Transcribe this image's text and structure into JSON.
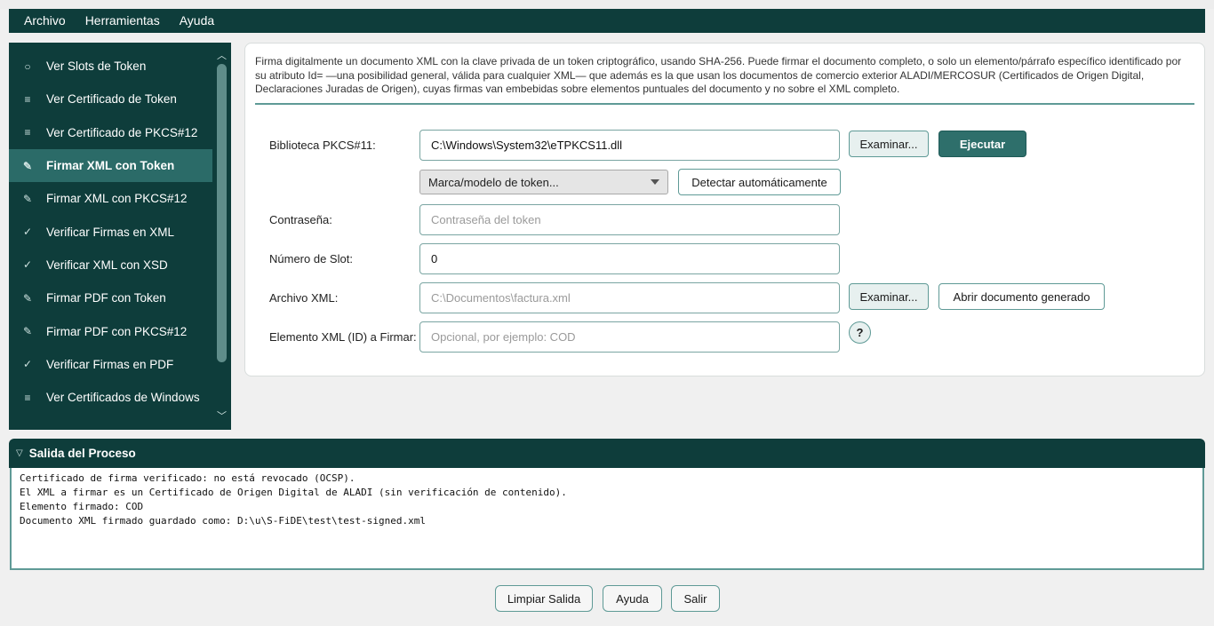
{
  "menubar": {
    "items": [
      "Archivo",
      "Herramientas",
      "Ayuda"
    ]
  },
  "sidebar": {
    "items": [
      {
        "icon": "○",
        "label": "Ver Slots de Token"
      },
      {
        "icon": "≡",
        "label": "Ver Certificado de Token"
      },
      {
        "icon": "≡",
        "label": "Ver Certificado de PKCS#12"
      },
      {
        "icon": "✎",
        "label": "Firmar XML con Token"
      },
      {
        "icon": "✎",
        "label": "Firmar XML con PKCS#12"
      },
      {
        "icon": "✓",
        "label": "Verificar Firmas en XML"
      },
      {
        "icon": "✓",
        "label": "Verificar XML con XSD"
      },
      {
        "icon": "✎",
        "label": "Firmar PDF con Token"
      },
      {
        "icon": "✎",
        "label": "Firmar PDF con PKCS#12"
      },
      {
        "icon": "✓",
        "label": "Verificar Firmas en PDF"
      },
      {
        "icon": "≡",
        "label": "Ver Certificados de Windows"
      }
    ],
    "active_label": "Firmar XML con Token"
  },
  "main": {
    "description": "Firma digitalmente un documento XML con la clave privada de un token criptográfico, usando SHA-256. Puede firmar el documento completo, o solo un elemento/párrafo específico identificado por su atributo Id= —una posibilidad general, válida para cualquier XML— que además es la que usan los documentos de comercio exterior ALADI/MERCOSUR (Certificados de Origen Digital, Declaraciones Juradas de Origen), cuyas firmas van embebidas sobre elementos puntuales del documento y no sobre el XML completo.",
    "library_label": "Biblioteca PKCS#11:",
    "library_value": "C:\\Windows\\System32\\eTPKCS11.dll",
    "browse_label": "Examinar...",
    "execute_label": "Ejecutar",
    "token_model_selected": "Marca/modelo de token...",
    "detect_label": "Detectar automáticamente",
    "password_label": "Contraseña:",
    "password_placeholder": "Contraseña del token",
    "slot_label": "Número de Slot:",
    "slot_value": "0",
    "xml_file_label": "Archivo XML:",
    "xml_file_placeholder": "C:\\Documentos\\factura.xml",
    "browse_xml_label": "Examinar...",
    "open_generated_label": "Abrir documento generado",
    "element_label": "Elemento XML (ID) a Firmar:",
    "element_placeholder": "Opcional, por ejemplo: COD",
    "help_label": "?"
  },
  "output": {
    "title": "Salida del Proceso",
    "lines": "Certificado de firma verificado: no está revocado (OCSP).\nEl XML a firmar es un Certificado de Origen Digital de ALADI (sin verificación de contenido).\nElemento firmado: COD\nDocumento XML firmado guardado como: D:\\u\\S-FiDE\\test\\test-signed.xml"
  },
  "footer": {
    "clear_label": "Limpiar Salida",
    "help_label": "Ayuda",
    "exit_label": "Salir"
  },
  "colors": {
    "dark_teal": "#0e3d3b",
    "active_item": "#2b6b68",
    "primary_button": "#2e6f6b",
    "border_teal": "#5f9a96"
  }
}
